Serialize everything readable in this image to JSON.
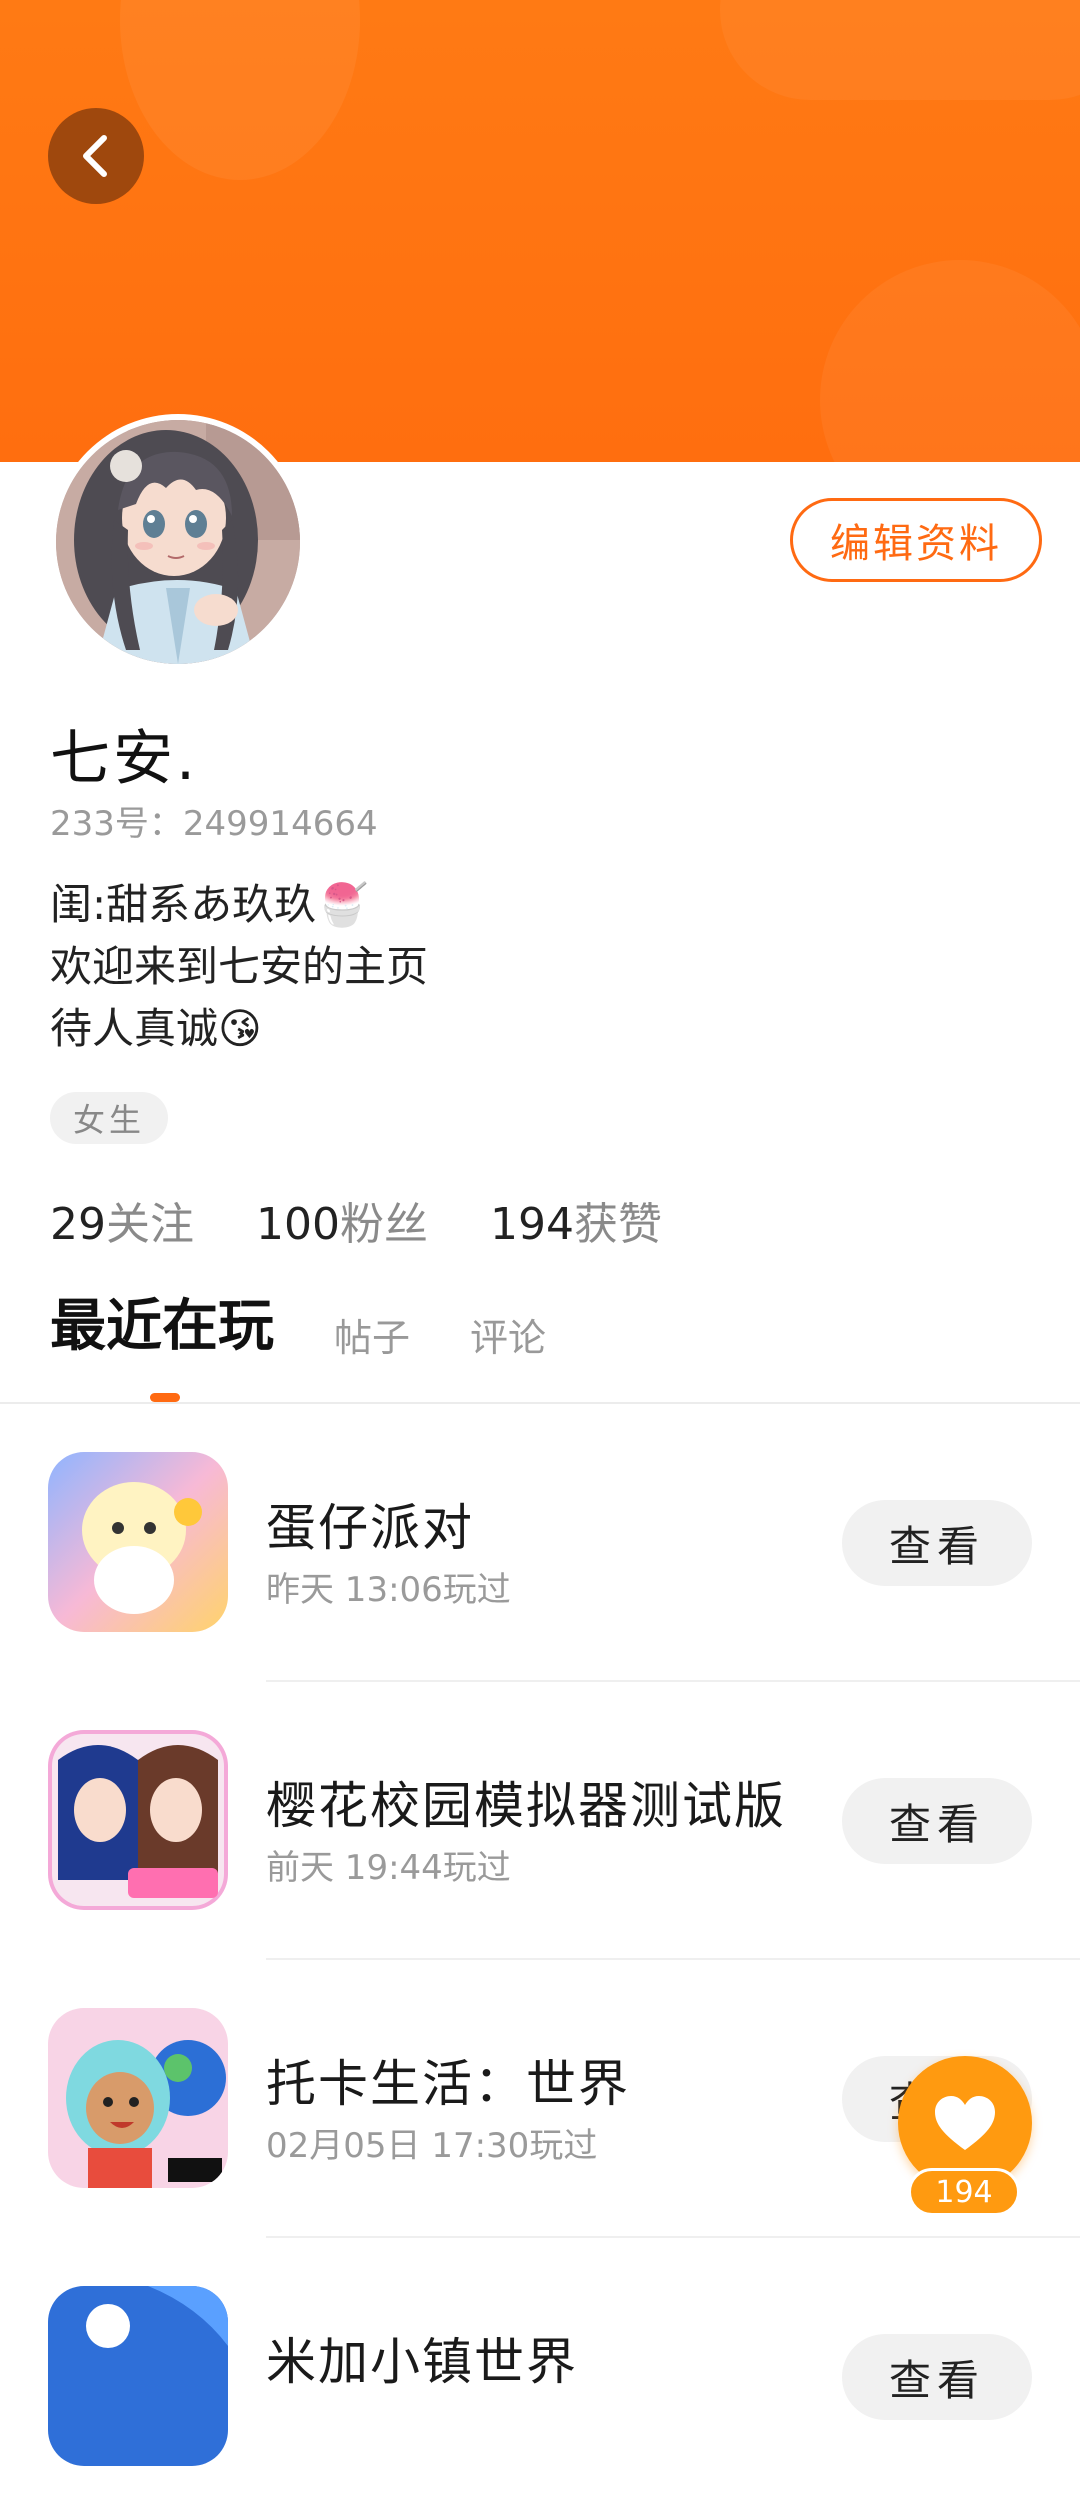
{
  "profile": {
    "nickname": "七安.",
    "uid_label": "233号：",
    "uid": "249914664",
    "edit_button": "编辑资料",
    "bio_lines": [
      "闺:甜系あ玖玖🍧",
      "欢迎来到七安的主页",
      "待人真诚😘"
    ],
    "gender_tag": "女生"
  },
  "stats": {
    "following_count": "29",
    "following_label": "关注",
    "followers_count": "100",
    "followers_label": "粉丝",
    "likes_count": "194",
    "likes_label": "获赞"
  },
  "tabs": [
    {
      "label": "最近在玩",
      "active": true
    },
    {
      "label": "帖子",
      "active": false
    },
    {
      "label": "评论",
      "active": false
    }
  ],
  "games": [
    {
      "title": "蛋仔派对",
      "time": "昨天 13:06玩过",
      "button": "查看"
    },
    {
      "title": "樱花校园模拟器测试版",
      "time": "前天 19:44玩过",
      "button": "查看"
    },
    {
      "title": "托卡生活：世界",
      "time": "02月05日 17:30玩过",
      "button": "查看"
    },
    {
      "title": "米加小镇世界",
      "time": "",
      "button": "查看"
    }
  ],
  "fab": {
    "like_count": "194"
  },
  "colors": {
    "accent": "#ff6a12",
    "banner": "#ff7a14",
    "fab": "#ff9a10"
  }
}
